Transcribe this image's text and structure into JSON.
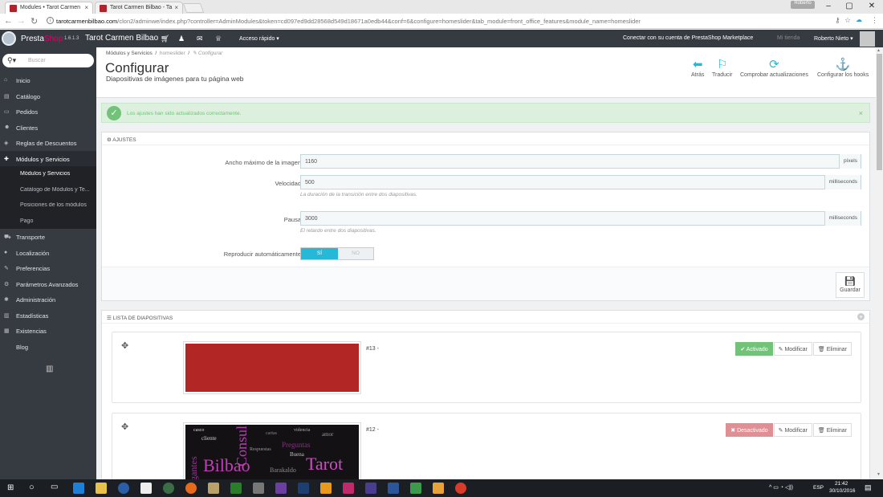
{
  "browser": {
    "tabs": [
      {
        "label": "Modules • Tarot Carmen",
        "active": true
      },
      {
        "label": "Tarot Carmen Bilbao - Ta",
        "active": false
      }
    ],
    "profile": "Roberto",
    "url_domain": "tarotcarmenbilbao.com",
    "url_rest": "/clon2/adminwe/index.php?controller=AdminModules&token=cd097ed9dd28568d549d18671a0edb44&conf=6&configure=homeslider&tab_module=front_office_features&module_name=homeslider"
  },
  "header": {
    "brand_presta": "Presta",
    "brand_shop": "Shop",
    "version": "1.6.1.3",
    "shop_name": "Tarot Carmen Bilbao",
    "quick_access": "Acceso rápido ▾",
    "connect": "Conectar con su cuenta de PrestaShop Marketplace",
    "my_shop": "Mi tienda",
    "user": "Roberto Nieto ▾"
  },
  "sidebar": {
    "search_placeholder": "Buscar",
    "items": [
      {
        "icon": "home-icon",
        "label": "Inicio"
      },
      {
        "icon": "catalog-icon",
        "label": "Catálogo"
      },
      {
        "icon": "credit-card-icon",
        "label": "Pedidos"
      },
      {
        "icon": "users-icon",
        "label": "Clientes"
      },
      {
        "icon": "tag-icon",
        "label": "Reglas de Descuentos"
      },
      {
        "icon": "puzzle-icon",
        "label": "Módulos y Servicios"
      },
      {
        "icon": "truck-icon",
        "label": "Transporte"
      },
      {
        "icon": "globe-icon",
        "label": "Localización"
      },
      {
        "icon": "wrench-icon",
        "label": "Preferencias"
      },
      {
        "icon": "cogs-icon",
        "label": "Parámetros Avanzados"
      },
      {
        "icon": "gear-icon",
        "label": "Administración"
      },
      {
        "icon": "bar-chart-icon",
        "label": "Estadísticas"
      },
      {
        "icon": "stock-icon",
        "label": "Existencias"
      },
      {
        "icon": "",
        "label": "Blog"
      }
    ],
    "subitems": [
      {
        "label": "Módulos y Servicios"
      },
      {
        "label": "Catálogo de Módulos y Te..."
      },
      {
        "label": "Posiciones de los módulos"
      },
      {
        "label": "Pago"
      }
    ]
  },
  "page": {
    "breadcrumb": {
      "c1": "Módulos y Servicios",
      "c2": "homeslider",
      "c3": "✎ Configurar"
    },
    "title": "Configurar",
    "subtitle": "Diapositivas de imágenes para tu página web",
    "toolbar": {
      "back": "Atrás",
      "translate": "Traducir",
      "check_updates": "Comprobar actualizaciones",
      "hooks": "Configurar los hooks"
    }
  },
  "alert": {
    "text": "Los ajustes han sido actualizados correctamente."
  },
  "settings": {
    "title": "AJUSTES",
    "width": {
      "label": "Ancho máximo de la imagen",
      "value": "1160",
      "suffix": "píxels"
    },
    "speed": {
      "label": "Velocidad",
      "value": "500",
      "suffix": "milliseconds",
      "help": "La duración de la transición entre dos diapositivas."
    },
    "pause": {
      "label": "Pausa",
      "value": "3000",
      "suffix": "milliseconds",
      "help": "El retardo entre dos diapositivas."
    },
    "autoplay": {
      "label": "Reproducir automáticamente",
      "yes": "SÍ",
      "no": "NO"
    },
    "save": "Guardar"
  },
  "slides": {
    "title": "LISTA DE DIAPOSITIVAS",
    "items": [
      {
        "id": "#13 -",
        "status": "✔ Activado",
        "modify": "Modificar",
        "delete": "Eliminar",
        "color": "#b32626"
      },
      {
        "id": "#12 -",
        "status": "✖ Desactivado",
        "modify": "Modificar",
        "delete": "Eliminar"
      }
    ],
    "wordcloud": [
      "Bilbao",
      "Consultas",
      "Tarot",
      "Barakaldo",
      "cliente",
      "casco",
      "Preguntas",
      "amor",
      "videncia",
      "Buena",
      "cartas",
      "Respuestas",
      "gantes"
    ]
  },
  "taskbar": {
    "lang": "ESP",
    "time": "21:42",
    "date": "30/10/2016"
  },
  "colors": {
    "accent": "#25b9d7",
    "success": "#72c279",
    "danger": "#e08f95",
    "sidebar": "#363a41",
    "brand_pink": "#df0067"
  }
}
